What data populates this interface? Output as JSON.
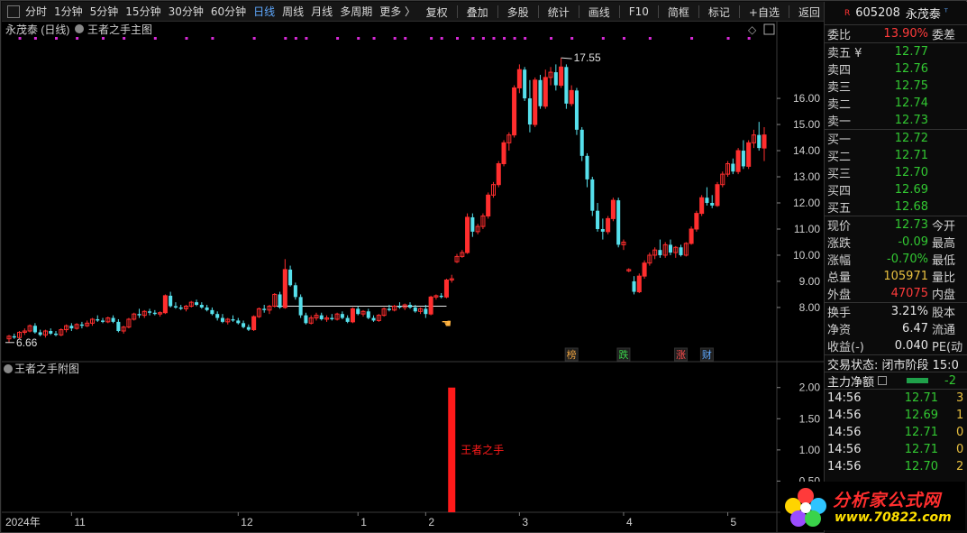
{
  "toolbar": {
    "left": [
      "分时",
      "1分钟",
      "5分钟",
      "15分钟",
      "30分钟",
      "60分钟",
      "日线",
      "周线",
      "月线",
      "多周期",
      "更多 〉"
    ],
    "right": [
      "复权",
      "叠加",
      "多股",
      "统计",
      "画线",
      "F10",
      "简框",
      "标记",
      "+自选",
      "返回"
    ],
    "active": "日线"
  },
  "main_panel": {
    "title_stock": "永茂泰 (日线)",
    "title_indicator": "王者之手主图"
  },
  "sub_panel": {
    "title": "王者之手附图",
    "signal_label": "王者之手"
  },
  "events": [
    "榜",
    "跌",
    "涨",
    "财"
  ],
  "colors": {
    "up": "#ff2e2e",
    "down": "#56e0ec",
    "magenta": "#d62ad6",
    "signal": "#ff1a1a"
  },
  "chart_data": [
    {
      "type": "candlestick",
      "ylim": [
        6.1,
        17.9
      ],
      "yticks": [
        "8.00",
        "9.00",
        "10.00",
        "11.00",
        "12.00",
        "13.00",
        "14.00",
        "15.00",
        "16.00"
      ],
      "xticks": [
        "2024年",
        "11",
        "12",
        "1",
        "2",
        "3",
        "4",
        "5"
      ],
      "annotations": {
        "high": "17.55",
        "low": "6.66"
      },
      "candles": [
        [
          6.8,
          6.95,
          6.66,
          6.9
        ],
        [
          6.9,
          7.0,
          6.8,
          6.85
        ],
        [
          6.85,
          7.1,
          6.8,
          7.05
        ],
        [
          7.05,
          7.2,
          6.95,
          7.1
        ],
        [
          7.1,
          7.35,
          7.05,
          7.3
        ],
        [
          7.3,
          7.4,
          7.0,
          7.05
        ],
        [
          7.05,
          7.15,
          6.9,
          6.95
        ],
        [
          6.95,
          7.15,
          6.85,
          7.1
        ],
        [
          7.1,
          7.2,
          6.95,
          7.0
        ],
        [
          7.0,
          7.1,
          6.9,
          6.95
        ],
        [
          6.95,
          7.2,
          6.9,
          7.15
        ],
        [
          7.15,
          7.35,
          7.05,
          7.3
        ],
        [
          7.3,
          7.4,
          7.1,
          7.2
        ],
        [
          7.2,
          7.4,
          7.15,
          7.35
        ],
        [
          7.35,
          7.45,
          7.2,
          7.3
        ],
        [
          7.3,
          7.5,
          7.25,
          7.4
        ],
        [
          7.4,
          7.6,
          7.3,
          7.55
        ],
        [
          7.55,
          7.7,
          7.45,
          7.5
        ],
        [
          7.5,
          7.6,
          7.4,
          7.45
        ],
        [
          7.45,
          7.65,
          7.4,
          7.6
        ],
        [
          7.6,
          7.7,
          7.4,
          7.45
        ],
        [
          7.45,
          7.55,
          7.05,
          7.1
        ],
        [
          7.1,
          7.3,
          7.0,
          7.25
        ],
        [
          7.25,
          7.6,
          7.2,
          7.55
        ],
        [
          7.55,
          7.8,
          7.5,
          7.75
        ],
        [
          7.75,
          7.95,
          7.6,
          7.7
        ],
        [
          7.7,
          7.9,
          7.6,
          7.85
        ],
        [
          7.85,
          7.95,
          7.7,
          7.8
        ],
        [
          7.8,
          7.9,
          7.7,
          7.75
        ],
        [
          7.75,
          7.85,
          7.65,
          7.8
        ],
        [
          7.8,
          8.5,
          7.75,
          8.45
        ],
        [
          8.45,
          8.6,
          8.0,
          8.05
        ],
        [
          8.05,
          8.2,
          7.95,
          8.0
        ],
        [
          8.0,
          8.1,
          7.9,
          7.95
        ],
        [
          7.95,
          8.1,
          7.85,
          8.05
        ],
        [
          8.05,
          8.25,
          8.0,
          8.2
        ],
        [
          8.2,
          8.3,
          8.05,
          8.1
        ],
        [
          8.1,
          8.2,
          7.95,
          8.0
        ],
        [
          8.0,
          8.1,
          7.85,
          7.9
        ],
        [
          7.9,
          8.0,
          7.7,
          7.75
        ],
        [
          7.75,
          7.85,
          7.5,
          7.6
        ],
        [
          7.6,
          7.75,
          7.4,
          7.45
        ],
        [
          7.45,
          7.6,
          7.35,
          7.55
        ],
        [
          7.55,
          7.7,
          7.45,
          7.5
        ],
        [
          7.5,
          7.6,
          7.35,
          7.4
        ],
        [
          7.4,
          7.5,
          7.2,
          7.25
        ],
        [
          7.25,
          7.35,
          7.1,
          7.15
        ],
        [
          7.15,
          7.7,
          7.1,
          7.65
        ],
        [
          7.65,
          8.0,
          7.6,
          7.95
        ],
        [
          7.95,
          8.1,
          7.8,
          7.9
        ],
        [
          7.9,
          8.1,
          7.75,
          8.05
        ],
        [
          8.05,
          8.55,
          8.0,
          8.5
        ],
        [
          8.5,
          8.6,
          7.95,
          8.0
        ],
        [
          8.0,
          9.85,
          7.95,
          9.45
        ],
        [
          9.45,
          9.6,
          8.8,
          8.85
        ],
        [
          8.85,
          8.95,
          8.3,
          8.4
        ],
        [
          8.4,
          8.5,
          7.6,
          7.7
        ],
        [
          7.7,
          7.8,
          7.35,
          7.4
        ],
        [
          7.4,
          7.7,
          7.35,
          7.6
        ],
        [
          7.6,
          7.8,
          7.5,
          7.7
        ],
        [
          7.7,
          7.8,
          7.5,
          7.55
        ],
        [
          7.55,
          7.7,
          7.45,
          7.6
        ],
        [
          7.6,
          7.75,
          7.5,
          7.55
        ],
        [
          7.55,
          7.8,
          7.5,
          7.75
        ],
        [
          7.75,
          7.85,
          7.55,
          7.6
        ],
        [
          7.6,
          7.7,
          7.4,
          7.45
        ],
        [
          7.45,
          8.0,
          7.4,
          7.95
        ],
        [
          7.95,
          8.05,
          7.7,
          7.75
        ],
        [
          7.75,
          7.9,
          7.65,
          7.85
        ],
        [
          7.85,
          7.95,
          7.55,
          7.6
        ],
        [
          7.6,
          7.7,
          7.45,
          7.5
        ],
        [
          7.5,
          7.75,
          7.45,
          7.7
        ],
        [
          7.7,
          8.0,
          7.65,
          7.95
        ],
        [
          7.95,
          8.1,
          7.85,
          7.9
        ],
        [
          7.9,
          8.1,
          7.85,
          8.05
        ],
        [
          8.05,
          8.2,
          7.95,
          8.0
        ],
        [
          8.0,
          8.15,
          7.9,
          8.1
        ],
        [
          8.1,
          8.2,
          7.95,
          8.0
        ],
        [
          8.0,
          8.1,
          7.8,
          7.85
        ],
        [
          7.85,
          8.0,
          7.75,
          7.95
        ],
        [
          7.95,
          8.1,
          7.6,
          7.75
        ],
        [
          7.75,
          8.45,
          7.7,
          8.4
        ],
        [
          8.4,
          8.5,
          8.3,
          8.45
        ],
        [
          8.45,
          8.55,
          8.35,
          8.4
        ],
        [
          8.4,
          9.1,
          8.35,
          9.05
        ],
        [
          9.05,
          9.25,
          8.95,
          9.1
        ],
        [
          9.75,
          10.05,
          9.7,
          9.95
        ],
        [
          9.95,
          10.2,
          9.9,
          10.1
        ],
        [
          10.1,
          11.6,
          10.05,
          11.45
        ],
        [
          11.45,
          11.6,
          10.7,
          10.9
        ],
        [
          10.9,
          11.2,
          10.8,
          11.1
        ],
        [
          11.1,
          11.6,
          11.0,
          11.5
        ],
        [
          11.5,
          12.4,
          11.4,
          12.3
        ],
        [
          12.3,
          12.8,
          12.2,
          12.7
        ],
        [
          12.7,
          13.6,
          12.6,
          13.5
        ],
        [
          13.5,
          14.4,
          13.4,
          14.3
        ],
        [
          14.3,
          14.7,
          14.0,
          14.6
        ],
        [
          14.6,
          16.5,
          14.5,
          16.4
        ],
        [
          16.4,
          17.3,
          16.2,
          17.1
        ],
        [
          17.1,
          17.2,
          15.9,
          16.0
        ],
        [
          16.0,
          16.7,
          14.7,
          15.0
        ],
        [
          15.0,
          16.8,
          14.9,
          16.7
        ],
        [
          16.7,
          16.9,
          15.6,
          15.7
        ],
        [
          15.7,
          17.1,
          15.6,
          16.8
        ],
        [
          16.8,
          17.2,
          16.5,
          17.0
        ],
        [
          17.0,
          17.3,
          16.3,
          16.5
        ],
        [
          16.5,
          17.55,
          16.4,
          17.2
        ],
        [
          17.2,
          17.3,
          15.6,
          15.8
        ],
        [
          15.8,
          16.5,
          15.7,
          16.3
        ],
        [
          16.3,
          16.4,
          14.6,
          14.8
        ],
        [
          14.8,
          14.9,
          13.6,
          13.8
        ],
        [
          13.8,
          13.9,
          12.6,
          12.9
        ],
        [
          12.9,
          13.0,
          11.5,
          11.7
        ],
        [
          11.7,
          12.0,
          10.9,
          11.0
        ],
        [
          11.0,
          11.4,
          10.6,
          10.9
        ],
        [
          10.9,
          11.5,
          10.8,
          11.4
        ],
        [
          11.4,
          12.2,
          11.3,
          12.1
        ],
        [
          12.1,
          12.2,
          10.3,
          10.4
        ],
        [
          10.4,
          10.6,
          10.2,
          10.5
        ],
        [
          9.4,
          9.5,
          9.35,
          9.45
        ],
        [
          9.0,
          9.2,
          8.5,
          8.6
        ],
        [
          8.6,
          9.3,
          8.55,
          9.2
        ],
        [
          9.2,
          9.8,
          9.1,
          9.7
        ],
        [
          9.7,
          10.1,
          9.6,
          10.0
        ],
        [
          10.0,
          10.3,
          9.85,
          10.2
        ],
        [
          10.2,
          10.6,
          9.9,
          10.0
        ],
        [
          10.0,
          10.5,
          9.9,
          10.4
        ],
        [
          10.4,
          10.6,
          10.0,
          10.1
        ],
        [
          10.1,
          10.35,
          9.9,
          10.3
        ],
        [
          10.3,
          10.4,
          9.95,
          10.0
        ],
        [
          10.0,
          10.5,
          9.95,
          10.45
        ],
        [
          10.45,
          11.1,
          10.4,
          11.0
        ],
        [
          11.0,
          11.7,
          10.9,
          11.6
        ],
        [
          11.6,
          12.3,
          11.5,
          12.2
        ],
        [
          12.2,
          12.6,
          11.9,
          12.0
        ],
        [
          12.0,
          12.3,
          11.8,
          11.9
        ],
        [
          11.9,
          12.8,
          11.85,
          12.7
        ],
        [
          12.7,
          13.2,
          12.6,
          13.1
        ],
        [
          13.1,
          13.6,
          13.0,
          13.5
        ],
        [
          13.5,
          13.7,
          13.1,
          13.2
        ],
        [
          13.2,
          14.1,
          13.1,
          14.0
        ],
        [
          14.0,
          14.4,
          13.3,
          13.4
        ],
        [
          13.4,
          14.4,
          13.3,
          14.3
        ],
        [
          14.3,
          14.8,
          14.1,
          14.6
        ],
        [
          14.6,
          15.1,
          14.0,
          14.1
        ],
        [
          14.1,
          14.9,
          13.6,
          14.6
        ]
      ]
    },
    {
      "type": "bar",
      "ylim": [
        0,
        2.3
      ],
      "yticks": [
        "0.50",
        "1.00",
        "1.50",
        "2.00"
      ],
      "signal": {
        "candle_index": 85,
        "value": 2.0
      }
    }
  ],
  "quote": {
    "code": "605208",
    "name": "永茂泰",
    "wei_bi_label": "委比",
    "wei_bi": "13.90%",
    "wei_cha_label": "委差",
    "asks": [
      {
        "label": "卖五 ¥",
        "price": "12.77"
      },
      {
        "label": "卖四",
        "price": "12.76"
      },
      {
        "label": "卖三",
        "price": "12.75"
      },
      {
        "label": "卖二",
        "price": "12.74"
      },
      {
        "label": "卖一",
        "price": "12.73"
      }
    ],
    "bids": [
      {
        "label": "买一",
        "price": "12.72"
      },
      {
        "label": "买二",
        "price": "12.71"
      },
      {
        "label": "买三",
        "price": "12.70"
      },
      {
        "label": "买四",
        "price": "12.69"
      },
      {
        "label": "买五",
        "price": "12.68"
      }
    ],
    "stats": [
      {
        "label": "现价",
        "value": "12.73",
        "color": "green",
        "right": "今开"
      },
      {
        "label": "涨跌",
        "value": "-0.09",
        "color": "green",
        "right": "最高"
      },
      {
        "label": "涨幅",
        "value": "-0.70%",
        "color": "green",
        "right": "最低"
      },
      {
        "label": "总量",
        "value": "105971",
        "color": "yellow",
        "right": "量比"
      },
      {
        "label": "外盘",
        "value": "47075",
        "color": "red",
        "right": "内盘"
      }
    ],
    "stats2": [
      {
        "label": "换手",
        "value": "3.21%",
        "right": "股本"
      },
      {
        "label": "净资",
        "value": "6.47",
        "right": "流通"
      },
      {
        "label": "收益(-)",
        "value": "0.040",
        "right": "PE(动"
      }
    ],
    "trade_state": "交易状态: 闭市阶段 15:0",
    "main_flow": "主力净额",
    "main_flow_value": "-2",
    "ticks": [
      {
        "time": "14:56",
        "price": "12.71",
        "color": "green",
        "vol": "3"
      },
      {
        "time": "14:56",
        "price": "12.69",
        "color": "green",
        "vol": "1"
      },
      {
        "time": "14:56",
        "price": "12.71",
        "color": "green",
        "vol": "0"
      },
      {
        "time": "14:56",
        "price": "12.71",
        "color": "green",
        "vol": "0"
      },
      {
        "time": "14:56",
        "price": "12.70",
        "color": "green",
        "vol": "2"
      }
    ]
  },
  "logo": {
    "brand": "分析家公式网",
    "url": "www.70822.com"
  }
}
